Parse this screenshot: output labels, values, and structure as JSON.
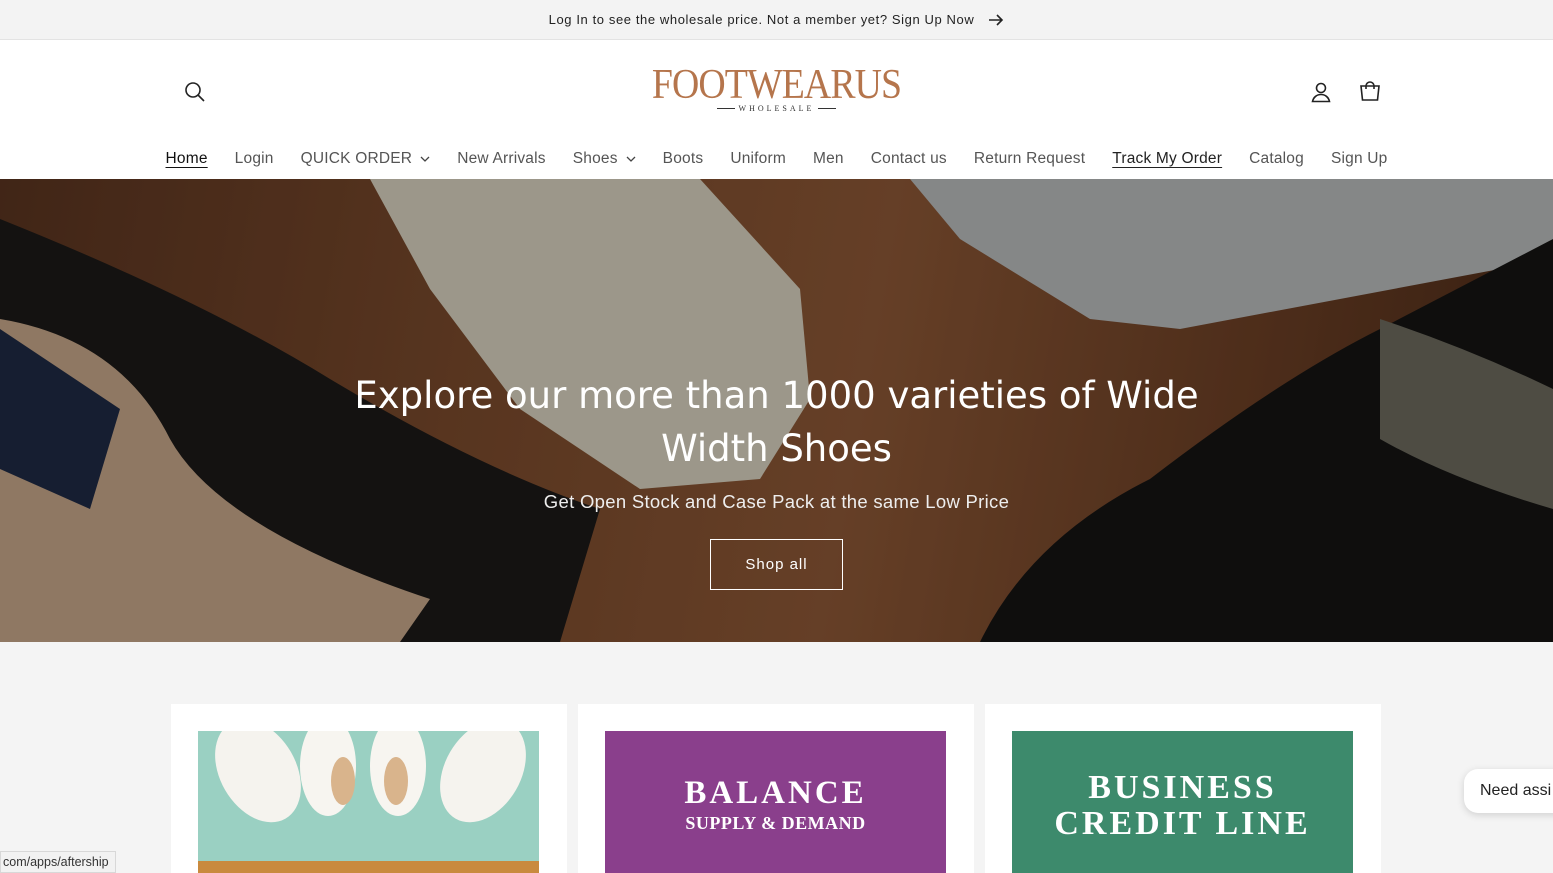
{
  "announcement": {
    "text": "Log In to see the wholesale price. Not a member yet? Sign Up Now"
  },
  "header": {
    "logo_main": "FOOTWEARUS",
    "logo_sub": "WHOLESALE"
  },
  "nav": {
    "items": [
      {
        "label": "Home"
      },
      {
        "label": "Login"
      },
      {
        "label": "QUICK ORDER"
      },
      {
        "label": "New Arrivals"
      },
      {
        "label": "Shoes"
      },
      {
        "label": "Boots"
      },
      {
        "label": "Uniform"
      },
      {
        "label": "Men"
      },
      {
        "label": "Contact us"
      },
      {
        "label": "Return Request"
      },
      {
        "label": "Track My Order"
      },
      {
        "label": "Catalog"
      },
      {
        "label": "Sign Up"
      }
    ]
  },
  "hero": {
    "title": "Explore our more than 1000 varieties of Wide Width Shoes",
    "subtitle": "Get Open Stock and Case Pack at the same Low Price",
    "button": "Shop all"
  },
  "cards": {
    "card2_line1": "BALANCE",
    "card2_line2": "SUPPLY & DEMAND",
    "card3_line1": "BUSINESS",
    "card3_line2": "CREDIT LINE"
  },
  "status_bar": {
    "url": "com/apps/aftership"
  },
  "chat": {
    "label": "Need assi"
  },
  "colors": {
    "logo": "#b5754c",
    "announcement_bg": "#f3f3f3",
    "cards_bg": "#f4f4f4"
  },
  "icons": {
    "search": "search-icon",
    "account": "user-icon",
    "cart": "cart-icon",
    "arrow": "arrow-right-icon",
    "caret": "chevron-down-icon"
  }
}
